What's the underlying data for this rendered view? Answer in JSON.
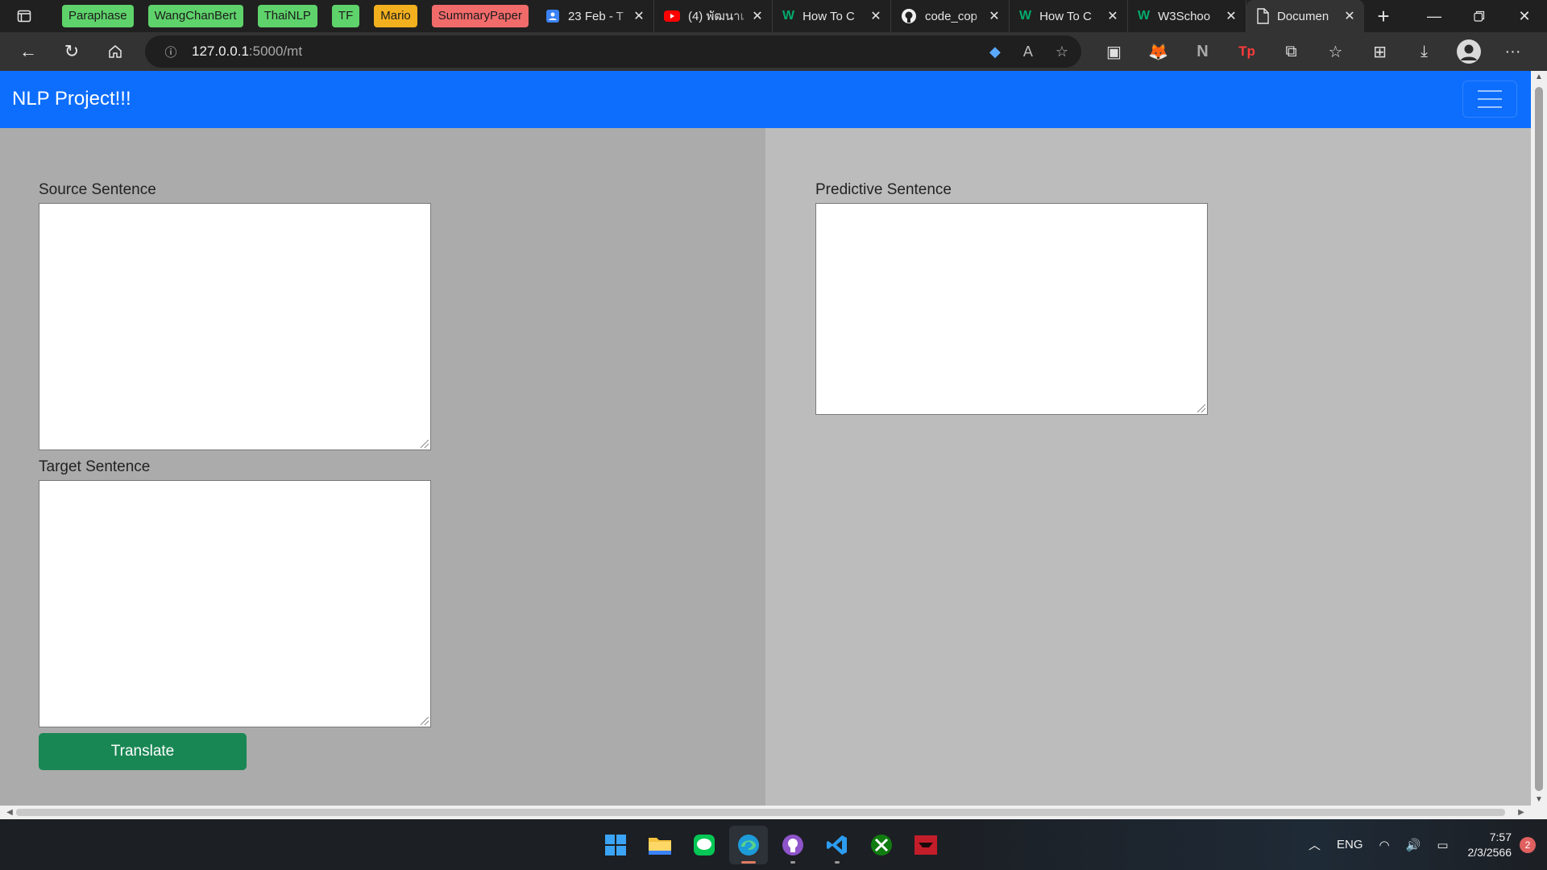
{
  "browser": {
    "favorites": [
      {
        "label": "Paraphase",
        "color": "#5fd36b"
      },
      {
        "label": "WangChanBert",
        "color": "#5fd36b"
      },
      {
        "label": "ThaiNLP",
        "color": "#5fd36b"
      },
      {
        "label": "TF",
        "color": "#5fd36b"
      },
      {
        "label": "Mario",
        "color": "#f2b01e"
      },
      {
        "label": "SummaryPaper",
        "color": "#f26b6b"
      }
    ],
    "tabs": [
      {
        "title": "23 Feb - T",
        "icon": "calendar-icon"
      },
      {
        "title": "(4) พัฒนาเ",
        "icon": "youtube-icon"
      },
      {
        "title": "How To C",
        "icon": "w3schools-icon"
      },
      {
        "title": "code_cop",
        "icon": "github-icon"
      },
      {
        "title": "How To C",
        "icon": "w3schools-icon"
      },
      {
        "title": "W3Schoo",
        "icon": "w3schools-icon"
      },
      {
        "title": "Documen",
        "icon": "document-icon",
        "active": true
      }
    ],
    "url_host": "127.0.0.1",
    "url_path": ":5000/mt"
  },
  "page": {
    "brand": "NLP Project!!!",
    "source_label": "Source Sentence",
    "source_value": "",
    "target_label": "Target Sentence",
    "target_value": "",
    "predictive_label": "Predictive Sentence",
    "predictive_value": "",
    "translate_button": "Translate",
    "accent_color": "#0d6efd",
    "button_color": "#198754"
  },
  "taskbar": {
    "apps": [
      "start-icon",
      "file-explorer-icon",
      "line-icon",
      "edge-icon",
      "github-desktop-icon",
      "vscode-icon",
      "xbox-icon",
      "game-app-icon"
    ],
    "tray": {
      "language": "ENG",
      "time": "7:57",
      "date": "2/3/2566",
      "notifications": "2"
    }
  }
}
